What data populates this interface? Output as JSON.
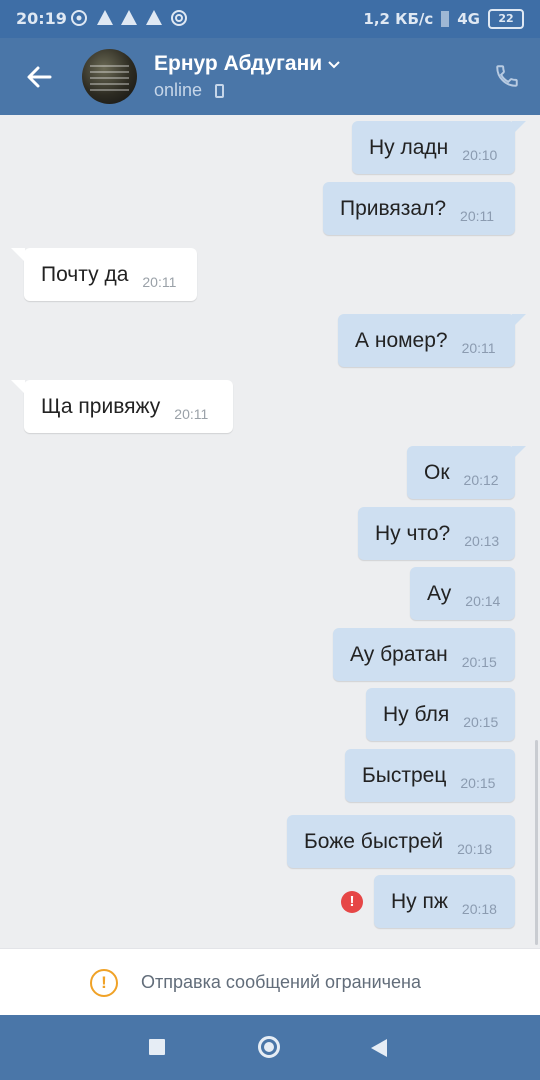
{
  "status_bar": {
    "time": "20:19",
    "speed": "1,2 КБ/с",
    "network": "4G",
    "battery": "22"
  },
  "header": {
    "name": "Ернур Абдугани",
    "status": "online"
  },
  "messages": [
    {
      "text": "Ну ладн",
      "time": "20:10",
      "dir": "out"
    },
    {
      "text": "Привязал?",
      "time": "20:11",
      "dir": "out"
    },
    {
      "text": "Почту да",
      "time": "20:11",
      "dir": "in"
    },
    {
      "text": "А номер?",
      "time": "20:11",
      "dir": "out"
    },
    {
      "text": "Ща привяжу",
      "time": "20:11",
      "dir": "in"
    },
    {
      "text": "Ок",
      "time": "20:12",
      "dir": "out"
    },
    {
      "text": "Ну что?",
      "time": "20:13",
      "dir": "out"
    },
    {
      "text": "Ау",
      "time": "20:14",
      "dir": "out"
    },
    {
      "text": "Ау братан",
      "time": "20:15",
      "dir": "out"
    },
    {
      "text": "Ну бля",
      "time": "20:15",
      "dir": "out"
    },
    {
      "text": "Быстрец",
      "time": "20:15",
      "dir": "out"
    },
    {
      "text": "Боже быстрей",
      "time": "20:18",
      "dir": "out"
    },
    {
      "text": "Ну пж",
      "time": "20:18",
      "dir": "out",
      "error": true
    }
  ],
  "restriction": {
    "text": "Отправка сообщений ограничена"
  },
  "colors": {
    "header": "#4a76a8",
    "outgoing_bubble": "#cedff1",
    "incoming_bubble": "#ffffff",
    "error": "#e64646",
    "warning": "#f0a227"
  }
}
